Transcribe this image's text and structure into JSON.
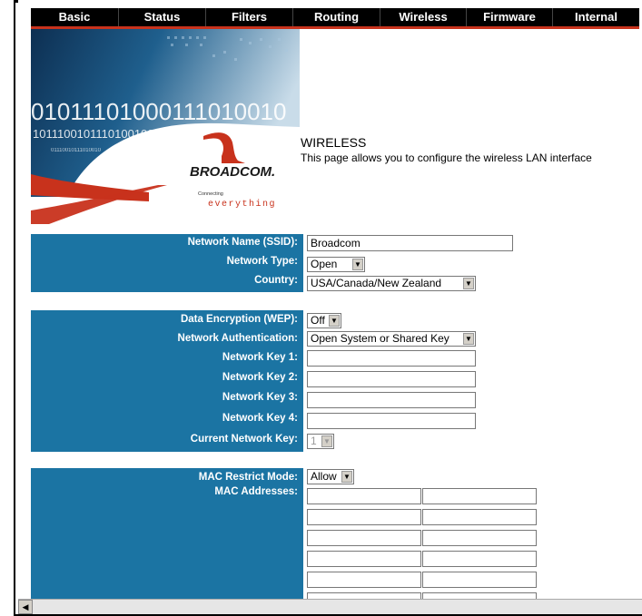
{
  "nav": {
    "items": [
      "Basic",
      "Status",
      "Filters",
      "Routing",
      "Wireless",
      "Firmware",
      "Internal"
    ]
  },
  "banner": {
    "binary_line_1": "01011101000111010010",
    "binary_line_2": "1011100101110100100",
    "binary_line_3": "01110010111010010",
    "brand": "BROADCOM.",
    "tagline_small": "Connecting",
    "tagline_big": "everything",
    "colors": {
      "red": "#c8321c",
      "blue": "#1b74a3"
    }
  },
  "page": {
    "title": "WIRELESS",
    "description": "This page allows you to configure the wireless LAN interface"
  },
  "basic": {
    "ssid_label": "Network Name (SSID):",
    "ssid_value": "Broadcom",
    "type_label": "Network Type:",
    "type_value": "Open",
    "country_label": "Country:",
    "country_value": "USA/Canada/New Zealand"
  },
  "security": {
    "wep_label": "Data Encryption (WEP):",
    "wep_value": "Off",
    "auth_label": "Network Authentication:",
    "auth_value": "Open System or Shared Key",
    "key1_label": "Network Key 1:",
    "key2_label": "Network Key 2:",
    "key3_label": "Network Key 3:",
    "key4_label": "Network Key 4:",
    "current_key_label": "Current Network Key:",
    "current_key_value": "1"
  },
  "mac": {
    "mode_label": "MAC Restrict Mode:",
    "mode_value": "Allow",
    "addresses_label": "MAC Addresses:"
  }
}
